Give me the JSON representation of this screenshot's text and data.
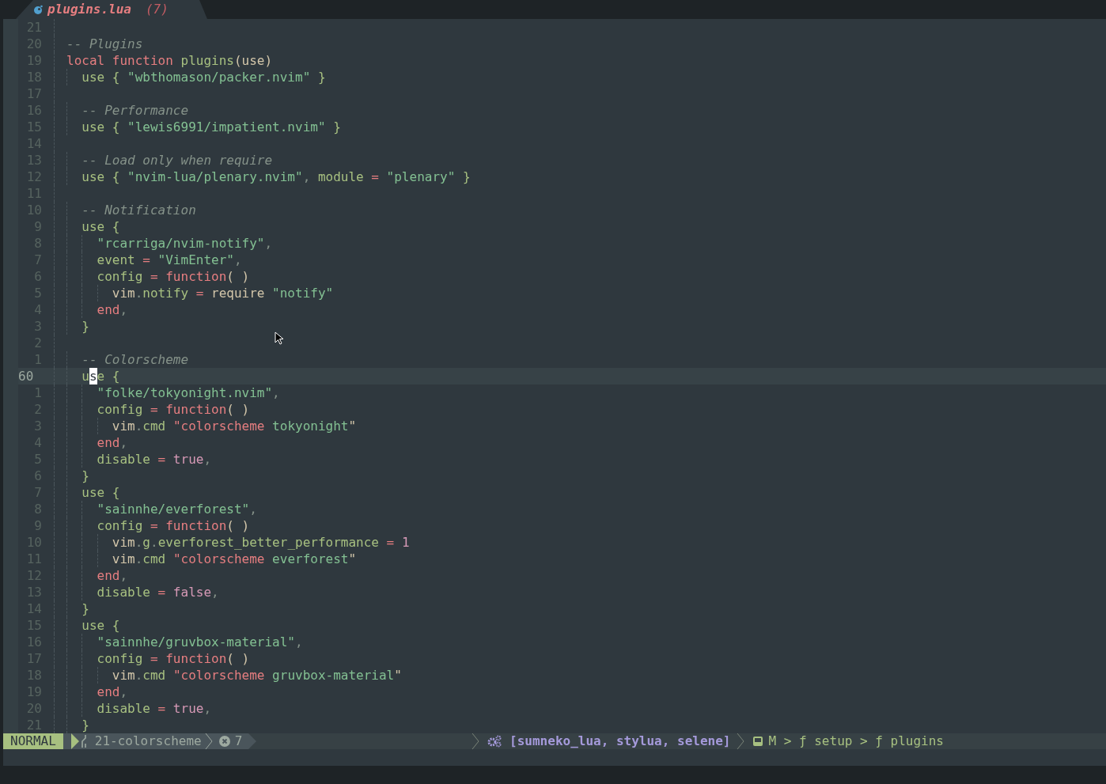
{
  "tab": {
    "filename": "plugins.lua",
    "count": "(7)"
  },
  "lines": [
    {
      "number": "21",
      "current": false
    },
    {
      "number": "20",
      "current": false,
      "tokens": [
        {
          "kind": "cmt",
          "text": "-- Plugins"
        }
      ]
    },
    {
      "number": "19",
      "current": false,
      "tokens": [
        {
          "kind": "kw",
          "text": "local"
        },
        {
          "kind": "kw",
          "text": " function"
        },
        {
          "kind": "fn",
          "text": " plugins"
        },
        {
          "kind": "punct",
          "text": "("
        },
        {
          "kind": "var",
          "text": "use"
        },
        {
          "kind": "punct",
          "text": ")"
        }
      ]
    },
    {
      "number": "18",
      "current": false,
      "tokens": [
        {
          "kind": "fn",
          "text": "  use"
        },
        {
          "kind": "fn",
          "text": " {"
        },
        {
          "kind": "str",
          "text": " \"wbthomason/packer.nvim\""
        },
        {
          "kind": "fn",
          "text": " }"
        }
      ]
    },
    {
      "number": "17",
      "current": false
    },
    {
      "number": "16",
      "current": false,
      "tokens": [
        {
          "kind": "cmt",
          "text": "  -- Performance"
        }
      ]
    },
    {
      "number": "15",
      "current": false,
      "tokens": [
        {
          "kind": "fn",
          "text": "  use"
        },
        {
          "kind": "fn",
          "text": " {"
        },
        {
          "kind": "str",
          "text": " \"lewis6991/impatient.nvim\""
        },
        {
          "kind": "fn",
          "text": " }"
        }
      ]
    },
    {
      "number": "14",
      "current": false
    },
    {
      "number": "13",
      "current": false,
      "tokens": [
        {
          "kind": "cmt",
          "text": "  -- Load only when require"
        }
      ]
    },
    {
      "number": "12",
      "current": false,
      "tokens": [
        {
          "kind": "fn",
          "text": "  use"
        },
        {
          "kind": "fn",
          "text": " {"
        },
        {
          "kind": "str",
          "text": " \"nvim-lua/plenary.nvim\""
        },
        {
          "kind": "sep",
          "text": ","
        },
        {
          "kind": "fn",
          "text": " module"
        },
        {
          "kind": "kw",
          "text": " ="
        },
        {
          "kind": "str",
          "text": " \"plenary\""
        },
        {
          "kind": "fn",
          "text": " }"
        }
      ]
    },
    {
      "number": "11",
      "current": false
    },
    {
      "number": "10",
      "current": false,
      "tokens": [
        {
          "kind": "cmt",
          "text": "  -- Notification"
        }
      ]
    },
    {
      "number": "9",
      "current": false,
      "tokens": [
        {
          "kind": "fn",
          "text": "  use"
        },
        {
          "kind": "fn",
          "text": " {"
        }
      ]
    },
    {
      "number": "8",
      "current": false,
      "tokens": [
        {
          "kind": "str",
          "text": "    \"rcarriga/nvim-notify\""
        },
        {
          "kind": "sep",
          "text": ","
        }
      ]
    },
    {
      "number": "7",
      "current": false,
      "tokens": [
        {
          "kind": "fn",
          "text": "    event"
        },
        {
          "kind": "kw",
          "text": " ="
        },
        {
          "kind": "str",
          "text": " \"VimEnter\""
        },
        {
          "kind": "sep",
          "text": ","
        }
      ]
    },
    {
      "number": "6",
      "current": false,
      "tokens": [
        {
          "kind": "fn",
          "text": "    config"
        },
        {
          "kind": "kw",
          "text": " ="
        },
        {
          "kind": "kw",
          "text": " function"
        },
        {
          "kind": "punct",
          "text": "( )"
        }
      ]
    },
    {
      "number": "5",
      "current": false,
      "tokens": [
        {
          "kind": "var",
          "text": "      vim"
        },
        {
          "kind": "sep",
          "text": "."
        },
        {
          "kind": "fn",
          "text": "notify"
        },
        {
          "kind": "kw",
          "text": " ="
        },
        {
          "kind": "var",
          "text": " require"
        },
        {
          "kind": "str",
          "text": " \"notify\""
        }
      ]
    },
    {
      "number": "4",
      "current": false,
      "tokens": [
        {
          "kind": "kw",
          "text": "    end"
        },
        {
          "kind": "sep",
          "text": ","
        }
      ]
    },
    {
      "number": "3",
      "current": false,
      "tokens": [
        {
          "kind": "fn",
          "text": "  }"
        }
      ]
    },
    {
      "number": "2",
      "current": false
    },
    {
      "number": "1",
      "current": false,
      "tokens": [
        {
          "kind": "cmt",
          "text": "  -- Colorscheme"
        }
      ]
    },
    {
      "number": "60",
      "current": true,
      "tokens": [
        {
          "kind": "fn",
          "text": "  u"
        },
        {
          "kind": "cursor",
          "text": "s"
        },
        {
          "kind": "fn",
          "text": "e"
        },
        {
          "kind": "fn",
          "text": " {"
        }
      ]
    },
    {
      "number": "1",
      "current": false,
      "tokens": [
        {
          "kind": "str",
          "text": "    \"folke/tokyonight.nvim\""
        },
        {
          "kind": "sep",
          "text": ","
        }
      ]
    },
    {
      "number": "2",
      "current": false,
      "tokens": [
        {
          "kind": "fn",
          "text": "    config"
        },
        {
          "kind": "kw",
          "text": " ="
        },
        {
          "kind": "kw",
          "text": " function"
        },
        {
          "kind": "punct",
          "text": "( )"
        }
      ]
    },
    {
      "number": "3",
      "current": false,
      "tokens": [
        {
          "kind": "var",
          "text": "      vim"
        },
        {
          "kind": "sep",
          "text": "."
        },
        {
          "kind": "fn",
          "text": "cmd"
        },
        {
          "kind": "kw",
          "text": " \"colorscheme"
        },
        {
          "kind": "str",
          "text": " tokyonight"
        },
        {
          "kind": "punct",
          "text": "\""
        }
      ]
    },
    {
      "number": "4",
      "current": false,
      "tokens": [
        {
          "kind": "kw",
          "text": "    end"
        },
        {
          "kind": "sep",
          "text": ","
        }
      ]
    },
    {
      "number": "5",
      "current": false,
      "tokens": [
        {
          "kind": "fn",
          "text": "    disable"
        },
        {
          "kind": "kw",
          "text": " ="
        },
        {
          "kind": "const",
          "text": " true"
        },
        {
          "kind": "sep",
          "text": ","
        }
      ]
    },
    {
      "number": "6",
      "current": false,
      "tokens": [
        {
          "kind": "fn",
          "text": "  }"
        }
      ]
    },
    {
      "number": "7",
      "current": false,
      "tokens": [
        {
          "kind": "fn",
          "text": "  use"
        },
        {
          "kind": "fn",
          "text": " {"
        }
      ]
    },
    {
      "number": "8",
      "current": false,
      "tokens": [
        {
          "kind": "str",
          "text": "    \"sainnhe/everforest\""
        },
        {
          "kind": "sep",
          "text": ","
        }
      ]
    },
    {
      "number": "9",
      "current": false,
      "tokens": [
        {
          "kind": "fn",
          "text": "    config"
        },
        {
          "kind": "kw",
          "text": " ="
        },
        {
          "kind": "kw",
          "text": " function"
        },
        {
          "kind": "punct",
          "text": "( )"
        }
      ]
    },
    {
      "number": "10",
      "current": false,
      "tokens": [
        {
          "kind": "var",
          "text": "      vim"
        },
        {
          "kind": "sep",
          "text": "."
        },
        {
          "kind": "fn",
          "text": "g"
        },
        {
          "kind": "sep",
          "text": "."
        },
        {
          "kind": "fn",
          "text": "everforest_better_performance"
        },
        {
          "kind": "kw",
          "text": " ="
        },
        {
          "kind": "const",
          "text": " 1"
        }
      ]
    },
    {
      "number": "11",
      "current": false,
      "tokens": [
        {
          "kind": "var",
          "text": "      vim"
        },
        {
          "kind": "sep",
          "text": "."
        },
        {
          "kind": "fn",
          "text": "cmd"
        },
        {
          "kind": "kw",
          "text": " \"colorscheme"
        },
        {
          "kind": "str",
          "text": " everforest"
        },
        {
          "kind": "punct",
          "text": "\""
        }
      ]
    },
    {
      "number": "12",
      "current": false,
      "tokens": [
        {
          "kind": "kw",
          "text": "    end"
        },
        {
          "kind": "sep",
          "text": ","
        }
      ]
    },
    {
      "number": "13",
      "current": false,
      "tokens": [
        {
          "kind": "fn",
          "text": "    disable"
        },
        {
          "kind": "kw",
          "text": " ="
        },
        {
          "kind": "const",
          "text": " false"
        },
        {
          "kind": "sep",
          "text": ","
        }
      ]
    },
    {
      "number": "14",
      "current": false,
      "tokens": [
        {
          "kind": "fn",
          "text": "  }"
        }
      ]
    },
    {
      "number": "15",
      "current": false,
      "tokens": [
        {
          "kind": "fn",
          "text": "  use"
        },
        {
          "kind": "fn",
          "text": " {"
        }
      ]
    },
    {
      "number": "16",
      "current": false,
      "tokens": [
        {
          "kind": "str",
          "text": "    \"sainnhe/gruvbox-material\""
        },
        {
          "kind": "sep",
          "text": ","
        }
      ]
    },
    {
      "number": "17",
      "current": false,
      "tokens": [
        {
          "kind": "fn",
          "text": "    config"
        },
        {
          "kind": "kw",
          "text": " ="
        },
        {
          "kind": "kw",
          "text": " function"
        },
        {
          "kind": "punct",
          "text": "( )"
        }
      ]
    },
    {
      "number": "18",
      "current": false,
      "tokens": [
        {
          "kind": "var",
          "text": "      vim"
        },
        {
          "kind": "sep",
          "text": "."
        },
        {
          "kind": "fn",
          "text": "cmd"
        },
        {
          "kind": "kw",
          "text": " \"colorscheme"
        },
        {
          "kind": "str",
          "text": " gruvbox-material"
        },
        {
          "kind": "punct",
          "text": "\""
        }
      ]
    },
    {
      "number": "19",
      "current": false,
      "tokens": [
        {
          "kind": "kw",
          "text": "    end"
        },
        {
          "kind": "sep",
          "text": ","
        }
      ]
    },
    {
      "number": "20",
      "current": false,
      "tokens": [
        {
          "kind": "fn",
          "text": "    disable"
        },
        {
          "kind": "kw",
          "text": " ="
        },
        {
          "kind": "const",
          "text": " true"
        },
        {
          "kind": "sep",
          "text": ","
        }
      ]
    },
    {
      "number": "21",
      "current": false,
      "tokens": [
        {
          "kind": "fn",
          "text": "  }"
        }
      ]
    }
  ],
  "status_bar": {
    "mode": "NORMAL",
    "branch": "21-colorscheme",
    "errors": "7",
    "lsp_clients": "[sumneko_lua, stylua, selene]",
    "breadcrumb": "M > ƒ setup > ƒ plugins"
  }
}
